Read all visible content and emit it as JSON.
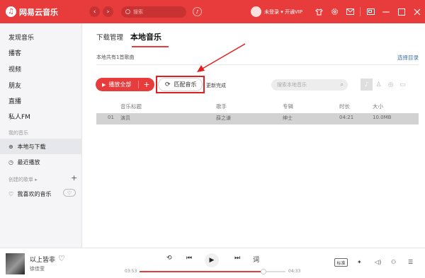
{
  "app": {
    "title": "网易云音乐",
    "logo_glyph": "♫",
    "brand_color": "#e83c3c"
  },
  "topbar": {
    "back_glyph": "‹",
    "forward_glyph": "›",
    "search_placeholder": "搜索",
    "mic_glyph": "♪",
    "user_label": "未登录 ▾ 开通VIP",
    "icons": [
      "shirt-icon",
      "settings-icon",
      "mail-icon",
      "mini-mode-icon",
      "minimize-icon",
      "maximize-icon",
      "close-icon"
    ]
  },
  "sidebar": {
    "items": [
      {
        "label": "发现音乐"
      },
      {
        "label": "播客"
      },
      {
        "label": "视频"
      },
      {
        "label": "朋友"
      },
      {
        "label": "直播"
      },
      {
        "label": "私人FM"
      }
    ],
    "my_music_header": "我的音乐",
    "my_music": [
      {
        "label": "本地与下载",
        "icon": "download-icon",
        "active": true
      },
      {
        "label": "最近播放",
        "icon": "history-icon"
      }
    ],
    "playlists_header": "创建的歌单 ▸",
    "add_glyph": "+",
    "liked": {
      "label": "我喜欢的音乐",
      "icon": "heart-icon"
    }
  },
  "main": {
    "tabs": [
      {
        "label": "下载管理"
      },
      {
        "label": "本地音乐",
        "active": true
      }
    ],
    "summary": "本地共有1首歌曲",
    "select_dir": "选择目录",
    "play_all": "播放全部",
    "add_glyph": "+",
    "match_music": "匹配音乐",
    "update_done": "更新完成",
    "local_search_placeholder": "搜索本地音乐",
    "table": {
      "headers": [
        "音乐标题",
        "歌手",
        "专辑",
        "时长",
        "大小"
      ],
      "rows": [
        {
          "index": "01",
          "title": "演员",
          "artist": "薛之谦",
          "album": "绅士",
          "duration": "04:21",
          "size": "10.0MB"
        }
      ]
    }
  },
  "player": {
    "song": "以上皆非",
    "artist": "徐佳莹",
    "current_time": "03:53",
    "total_time": "04:33",
    "progress": 0.85,
    "quality": "标准",
    "lyrics": "词"
  }
}
